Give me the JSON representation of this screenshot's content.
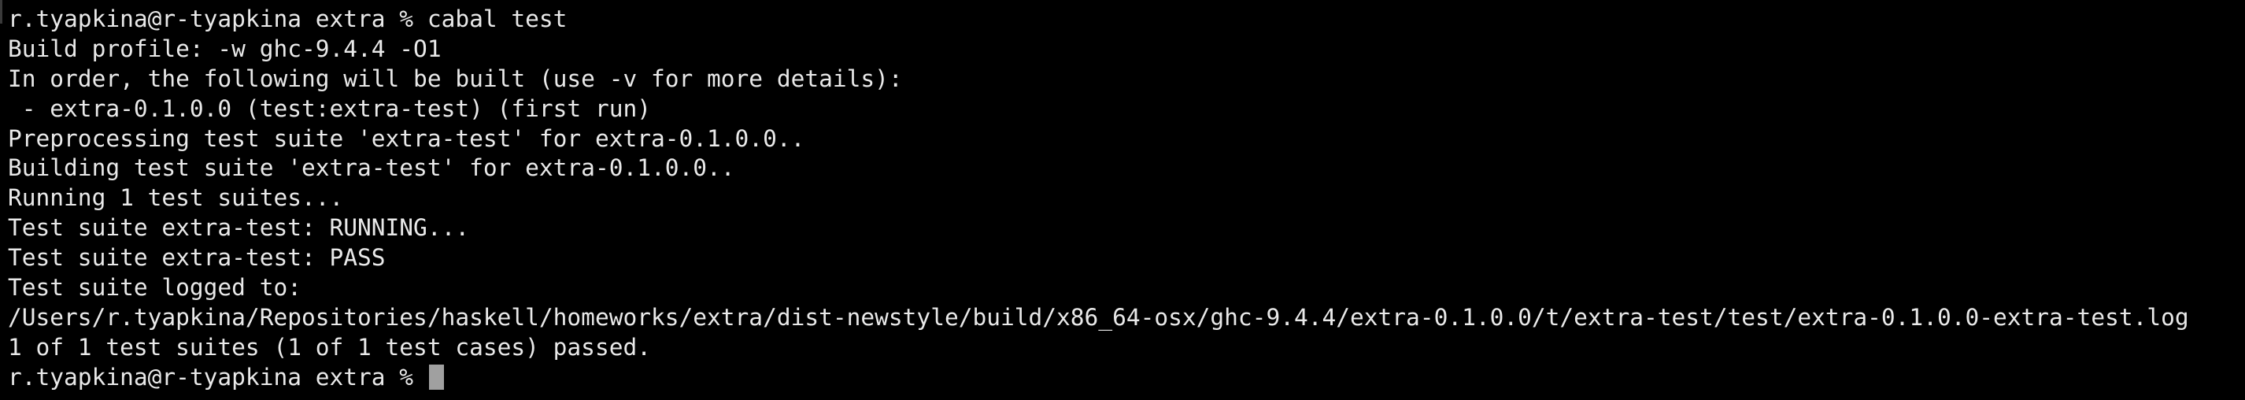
{
  "terminal": {
    "lines": [
      "r.tyapkina@r-tyapkina extra % cabal test",
      "Build profile: -w ghc-9.4.4 -O1",
      "In order, the following will be built (use -v for more details):",
      " - extra-0.1.0.0 (test:extra-test) (first run)",
      "Preprocessing test suite 'extra-test' for extra-0.1.0.0..",
      "Building test suite 'extra-test' for extra-0.1.0.0..",
      "Running 1 test suites...",
      "Test suite extra-test: RUNNING...",
      "Test suite extra-test: PASS",
      "Test suite logged to:",
      "/Users/r.tyapkina/Repositories/haskell/homeworks/extra/dist-newstyle/build/x86_64-osx/ghc-9.4.4/extra-0.1.0.0/t/extra-test/test/extra-0.1.0.0-extra-test.log",
      "1 of 1 test suites (1 of 1 test cases) passed."
    ],
    "prompt": "r.tyapkina@r-tyapkina extra % "
  },
  "colors": {
    "background": "#000000",
    "text": "#e9e9e9",
    "cursor": "#a0a0a0"
  }
}
